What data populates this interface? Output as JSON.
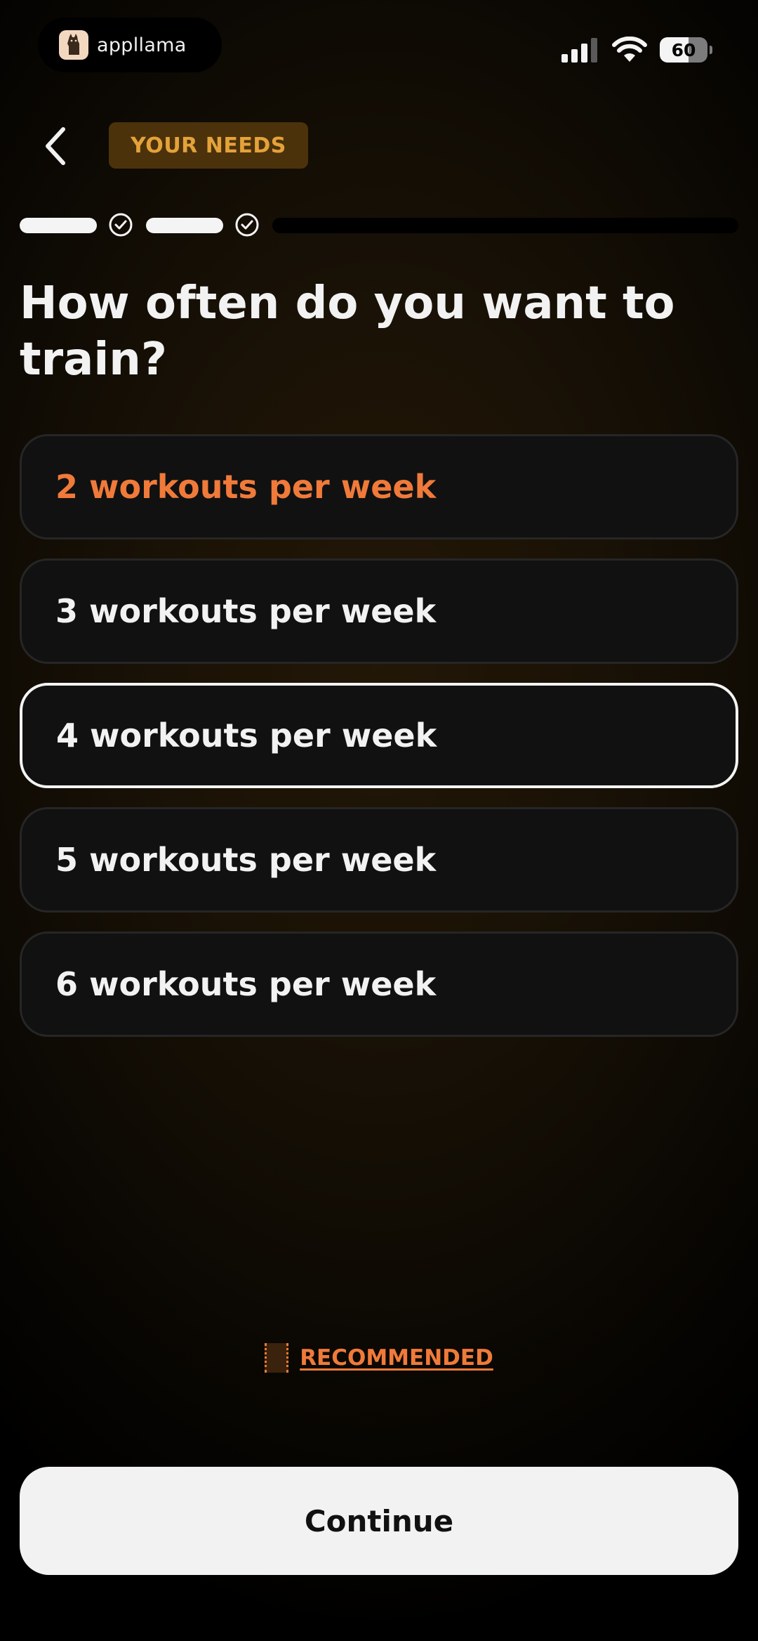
{
  "status_bar": {
    "app_name": "appllama",
    "battery": "60",
    "icons": [
      "llama-icon",
      "signal-icon",
      "wifi-icon",
      "battery-icon"
    ]
  },
  "header": {
    "back_icon": "chevron-left-icon",
    "section_label": "YOUR NEEDS"
  },
  "progress": {
    "completed_steps": 2,
    "step_icon": "check-circle-icon"
  },
  "question": "How often do you want to train?",
  "options": [
    {
      "label": "2 workouts per week",
      "recommended": true,
      "selected": false
    },
    {
      "label": "3 workouts per week",
      "recommended": false,
      "selected": false
    },
    {
      "label": "4 workouts per week",
      "recommended": false,
      "selected": true
    },
    {
      "label": "5 workouts per week",
      "recommended": false,
      "selected": false
    },
    {
      "label": "6 workouts per week",
      "recommended": false,
      "selected": false
    }
  ],
  "legend": {
    "label": "RECOMMENDED"
  },
  "continue_label": "Continue",
  "colors": {
    "accent_orange": "#f07a3a",
    "badge_text": "#e4a23a",
    "badge_bg": "#4b320b",
    "option_bg": "#111111",
    "button_bg": "#f2f2f2"
  }
}
